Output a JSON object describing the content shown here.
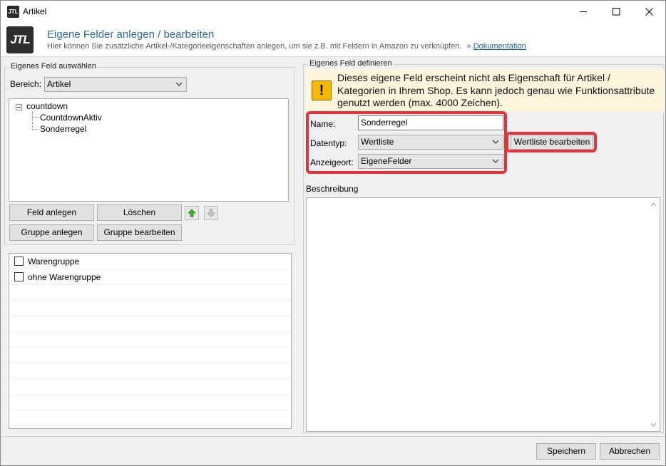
{
  "window": {
    "app_icon_text": "JTL",
    "title": "Artikel"
  },
  "header": {
    "logo_text": "JTL",
    "title": "Eigene Felder anlegen / bearbeiten",
    "subtitle": "Hier können Sie zusätzliche Artikel-/Kategorieeigenschaften anlegen, um sie z.B. mit Feldern in Amazon zu verknüpfen.",
    "separator": "»",
    "doc_link": "Dokumentation"
  },
  "left_panel": {
    "group_title": "Eigenes Feld auswählen",
    "bereich_label": "Bereich:",
    "bereich_value": "Artikel",
    "tree": {
      "root": "countdown",
      "children": [
        "CountdownAktiv",
        "Sonderregel"
      ]
    },
    "buttons": {
      "feld_anlegen": "Feld anlegen",
      "loeschen": "Löschen",
      "gruppe_anlegen": "Gruppe anlegen",
      "gruppe_bearbeiten": "Gruppe bearbeiten"
    },
    "checklist": [
      "Warengruppe",
      "ohne Warengruppe"
    ]
  },
  "right_panel": {
    "group_title": "Eigenes Feld definieren",
    "warning_text": "Dieses eigene Feld erscheint nicht als Eigenschaft für Artikel / Kategorien in Ihrem Shop. Es kann jedoch genau wie Funktionsattribute genutzt werden (max. 4000 Zeichen).",
    "name_label": "Name:",
    "name_value": "Sonderregel",
    "datentyp_label": "Datentyp:",
    "datentyp_value": "Wertliste",
    "anzeigeort_label": "Anzeigeort:",
    "anzeigeort_value": "EigeneFelder",
    "wertliste_button": "Wertliste bearbeiten",
    "beschreibung_label": "Beschreibung",
    "beschreibung_value": ""
  },
  "footer": {
    "save": "Speichern",
    "cancel": "Abbrechen"
  },
  "colors": {
    "highlight": "#e6323c",
    "header_title": "#2e6aa8",
    "warning_bg": "#fdf5dc"
  },
  "icons": {
    "warning": "warning-icon",
    "move_up": "arrow-up-icon",
    "move_down": "arrow-down-icon"
  }
}
